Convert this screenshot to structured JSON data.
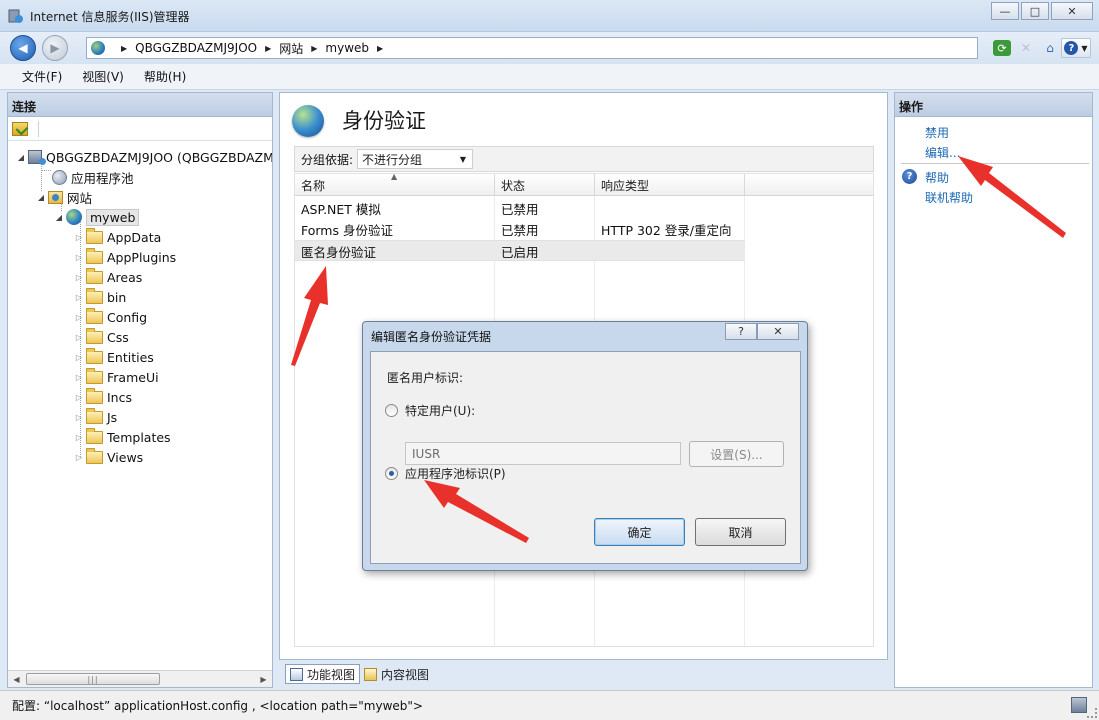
{
  "window": {
    "title": "Internet 信息服务(IIS)管理器",
    "minimize": "—",
    "maximize": "□",
    "close": "✕"
  },
  "nav": {
    "back": "◀",
    "forward": "▶",
    "crumbs": [
      "QBGGZBDAZMJ9JOO",
      "网站",
      "myweb"
    ],
    "help_glyph": "?"
  },
  "menu": [
    "文件(F)",
    "视图(V)",
    "帮助(H)"
  ],
  "connections": {
    "header": "连接",
    "tree": {
      "server": "QBGGZBDAZMJ9JOO (QBGGZBDAZM",
      "app_pools": "应用程序池",
      "sites": "网站",
      "site": "myweb",
      "folders": [
        "AppData",
        "AppPlugins",
        "Areas",
        "bin",
        "Config",
        "Css",
        "Entities",
        "FrameUi",
        "Incs",
        "Js",
        "Templates",
        "Views"
      ]
    }
  },
  "feature": {
    "title": "身份验证",
    "group_by_label": "分组依据:",
    "group_by_value": "不进行分组",
    "columns": [
      "名称",
      "状态",
      "响应类型"
    ],
    "rows": [
      {
        "name": "ASP.NET 模拟",
        "status": "已禁用",
        "response": ""
      },
      {
        "name": "Forms 身份验证",
        "status": "已禁用",
        "response": "HTTP 302 登录/重定向"
      },
      {
        "name": "匿名身份验证",
        "status": "已启用",
        "response": ""
      }
    ],
    "view_tabs": [
      "功能视图",
      "内容视图"
    ]
  },
  "actions": {
    "header": "操作",
    "items": [
      "禁用",
      "编辑..."
    ],
    "help_items": [
      "帮助",
      "联机帮助"
    ]
  },
  "status": {
    "text": "配置: “localhost” applicationHost.config , <location path=\"myweb\">"
  },
  "dialog": {
    "title": "编辑匿名身份验证凭据",
    "help_btn": "?",
    "close_btn": "✕",
    "identity_label": "匿名用户标识:",
    "specific_user_label": "特定用户(U):",
    "user_value": "IUSR",
    "set_button": "设置(S)...",
    "app_pool_label": "应用程序池标识(P)",
    "selected_option": "app_pool",
    "ok": "确定",
    "cancel": "取消"
  },
  "colors": {
    "link": "#1c68b5",
    "arrow": "#e8312a"
  }
}
